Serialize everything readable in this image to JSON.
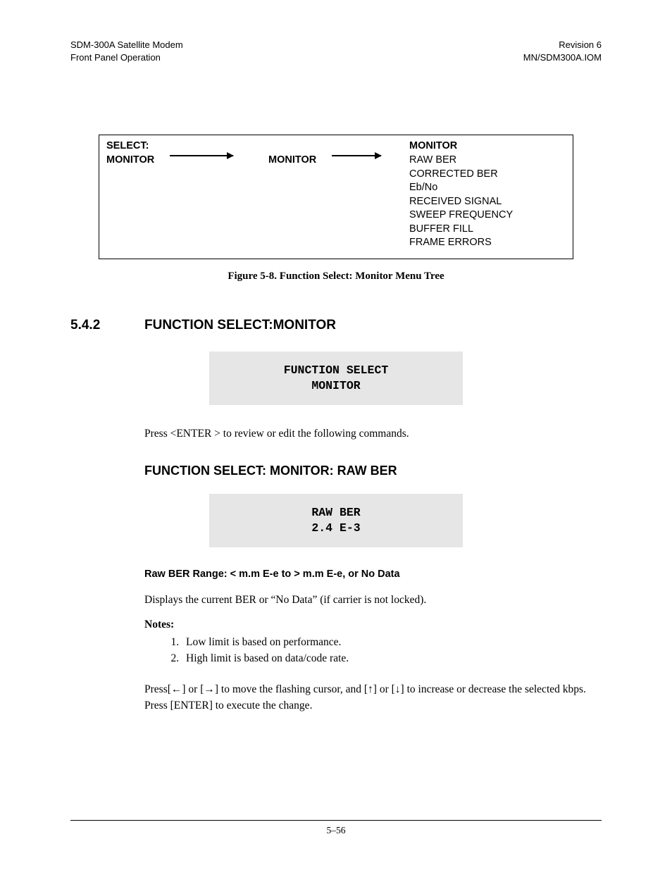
{
  "header": {
    "left1": "SDM-300A Satellite Modem",
    "left2": "Front Panel Operation",
    "right1": "Revision 6",
    "right2": "MN/SDM300A.IOM"
  },
  "menuTree": {
    "col1_line1": "SELECT:",
    "col1_line2": "MONITOR",
    "col2": "MONITOR",
    "col3_title": "MONITOR",
    "items": [
      "RAW BER",
      "CORRECTED BER",
      "Eb/No",
      "RECEIVED SIGNAL",
      "SWEEP FREQUENCY",
      "BUFFER FILL",
      "FRAME ERRORS"
    ]
  },
  "figureCaption": "Figure 5-8.  Function Select: Monitor Menu Tree",
  "section": {
    "number": "5.4.2",
    "title": "FUNCTION SELECT:MONITOR"
  },
  "lcd1": {
    "line1": "FUNCTION SELECT",
    "line2": "MONITOR"
  },
  "para1": "Press <ENTER > to review or edit the following commands.",
  "subHeading": "FUNCTION SELECT: MONITOR: RAW BER",
  "lcd2": {
    "line1": "RAW BER",
    "line2": "2.4 E-3"
  },
  "rangeLine": "Raw BER Range: < m.m E-e to > m.m E-e, or No Data",
  "para2": "Displays the current BER or “No Data” (if carrier is not locked).",
  "notesLabel": "Notes:",
  "notes": [
    "Low limit is based on performance.",
    "High limit is based on data/code rate."
  ],
  "para3": "Press[←] or [→] to move the flashing cursor, and [↑] or [↓] to increase or decrease the selected kbps. Press [ENTER] to execute the change.",
  "pageNumber": "5–56"
}
